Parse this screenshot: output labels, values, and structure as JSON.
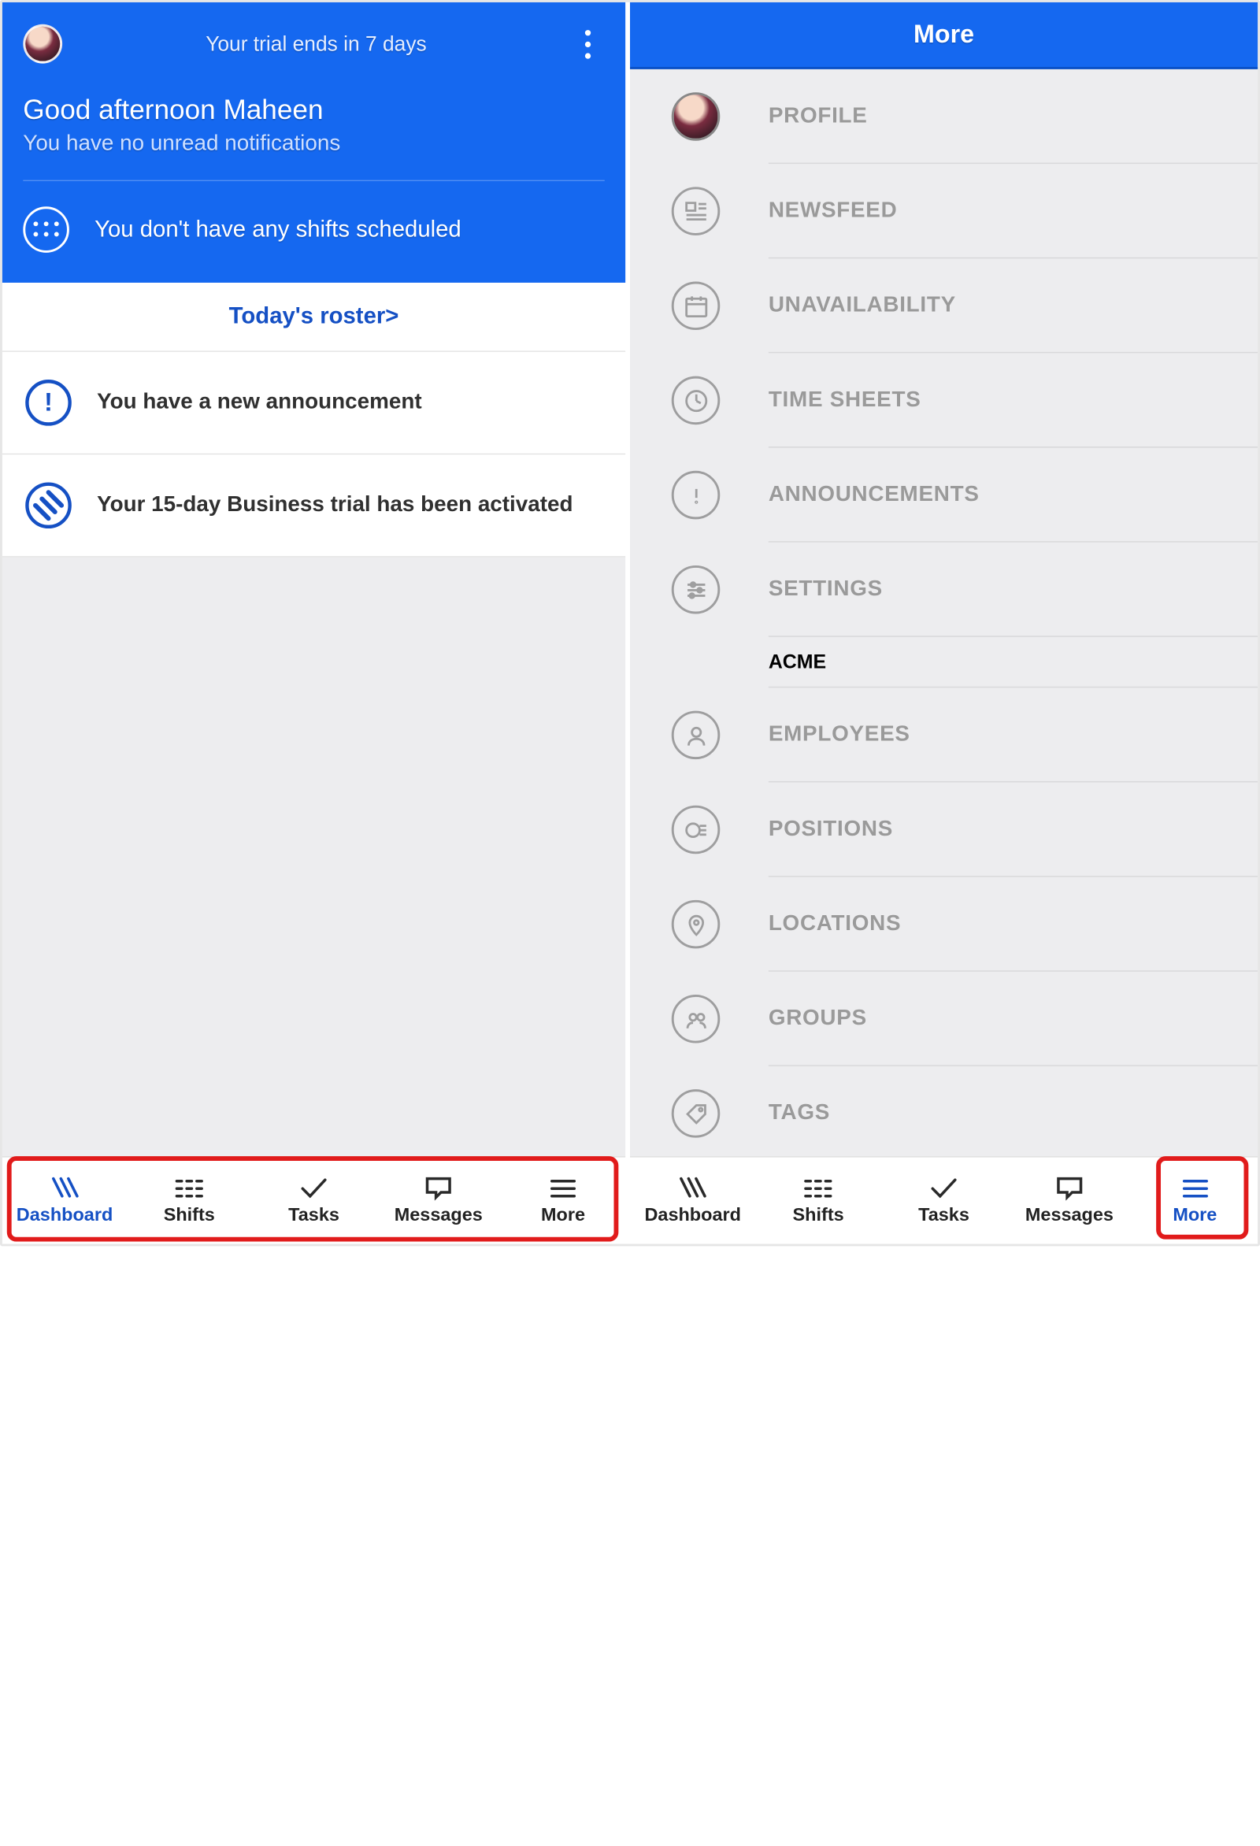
{
  "left": {
    "trial_text": "Your trial ends in 7 days",
    "greeting": "Good afternoon Maheen",
    "subtext": "You have no unread notifications",
    "no_shifts": "You don't have any shifts scheduled",
    "roster_link": "Today's roster>",
    "cards": {
      "announcement": "You have a new announcement",
      "trial_activated": "Your 15-day Business trial has been activated"
    }
  },
  "right": {
    "title": "More",
    "section": "ACME",
    "items": {
      "profile": "PROFILE",
      "newsfeed": "NEWSFEED",
      "unavailability": "UNAVAILABILITY",
      "timesheets": "TIME SHEETS",
      "announcements": "ANNOUNCEMENTS",
      "settings": "SETTINGS",
      "employees": "EMPLOYEES",
      "positions": "POSITIONS",
      "locations": "LOCATIONS",
      "groups": "GROUPS",
      "tags": "TAGS"
    }
  },
  "tabs": {
    "dashboard": "Dashboard",
    "shifts": "Shifts",
    "tasks": "Tasks",
    "messages": "Messages",
    "more": "More"
  }
}
